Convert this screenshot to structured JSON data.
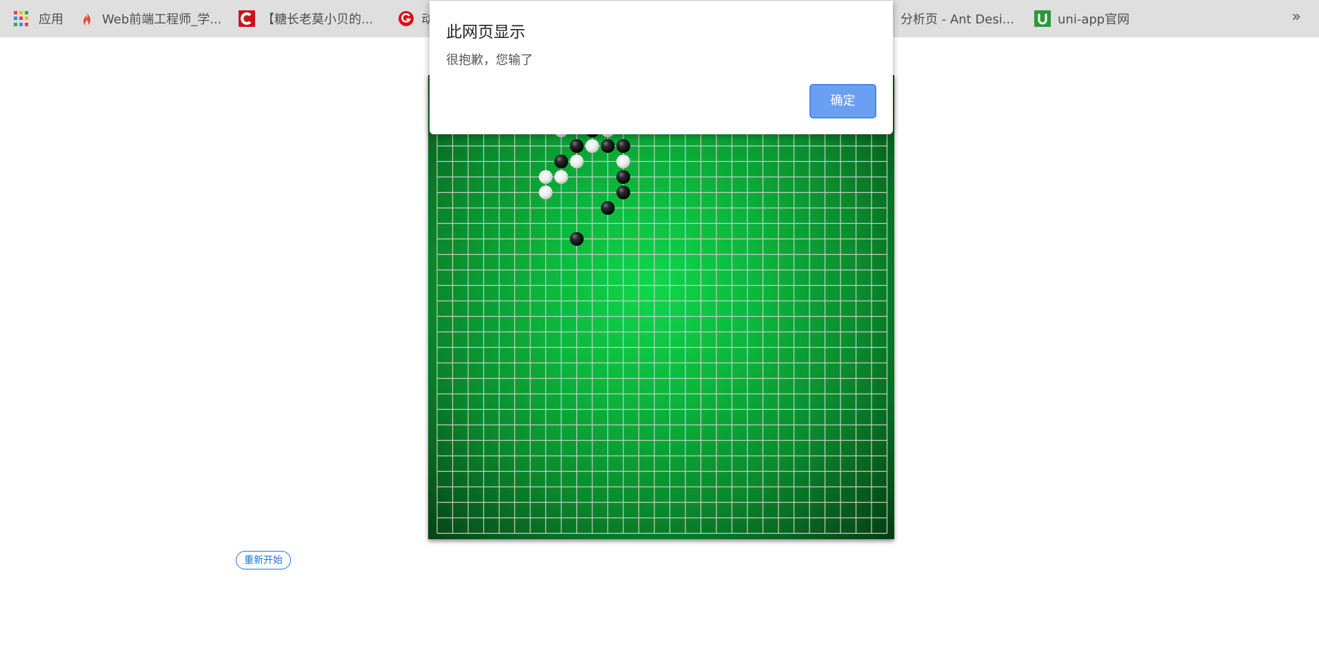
{
  "bookmarks": {
    "items": [
      {
        "label": "应用",
        "icon": "apps-grid-icon"
      },
      {
        "label": "Web前端工程师_学...",
        "icon": "flame-icon"
      },
      {
        "label": "【糖长老莫小贝的...",
        "icon": "c-logo-icon"
      },
      {
        "label": "动",
        "icon": "g-logo-icon"
      },
      {
        "label": "分析页 - Ant Desi...",
        "icon": "none"
      },
      {
        "label": "uni-app官网",
        "icon": "u-logo-icon"
      }
    ],
    "more_label": "»"
  },
  "game": {
    "grid_lines": 30,
    "black_stones": [
      [
        10,
        3
      ],
      [
        9,
        4
      ],
      [
        11,
        4
      ],
      [
        12,
        4
      ],
      [
        8,
        5
      ],
      [
        12,
        6
      ],
      [
        12,
        7
      ],
      [
        11,
        8
      ],
      [
        9,
        10
      ]
    ],
    "white_stones": [
      [
        11,
        2
      ],
      [
        8,
        3
      ],
      [
        11,
        3
      ],
      [
        10,
        4
      ],
      [
        9,
        5
      ],
      [
        12,
        5
      ],
      [
        7,
        6
      ],
      [
        8,
        6
      ],
      [
        7,
        7
      ]
    ],
    "restart_label": "重新开始"
  },
  "dialog": {
    "title": "此网页显示",
    "message": "很抱歉，您输了",
    "ok_label": "确定"
  },
  "colors": {
    "board_center": "#0fd84d",
    "board_edge": "#043d12",
    "grid_line": "#c8cfc9",
    "ok_button": "#6b9ff2",
    "restart_accent": "#1a73e8"
  }
}
